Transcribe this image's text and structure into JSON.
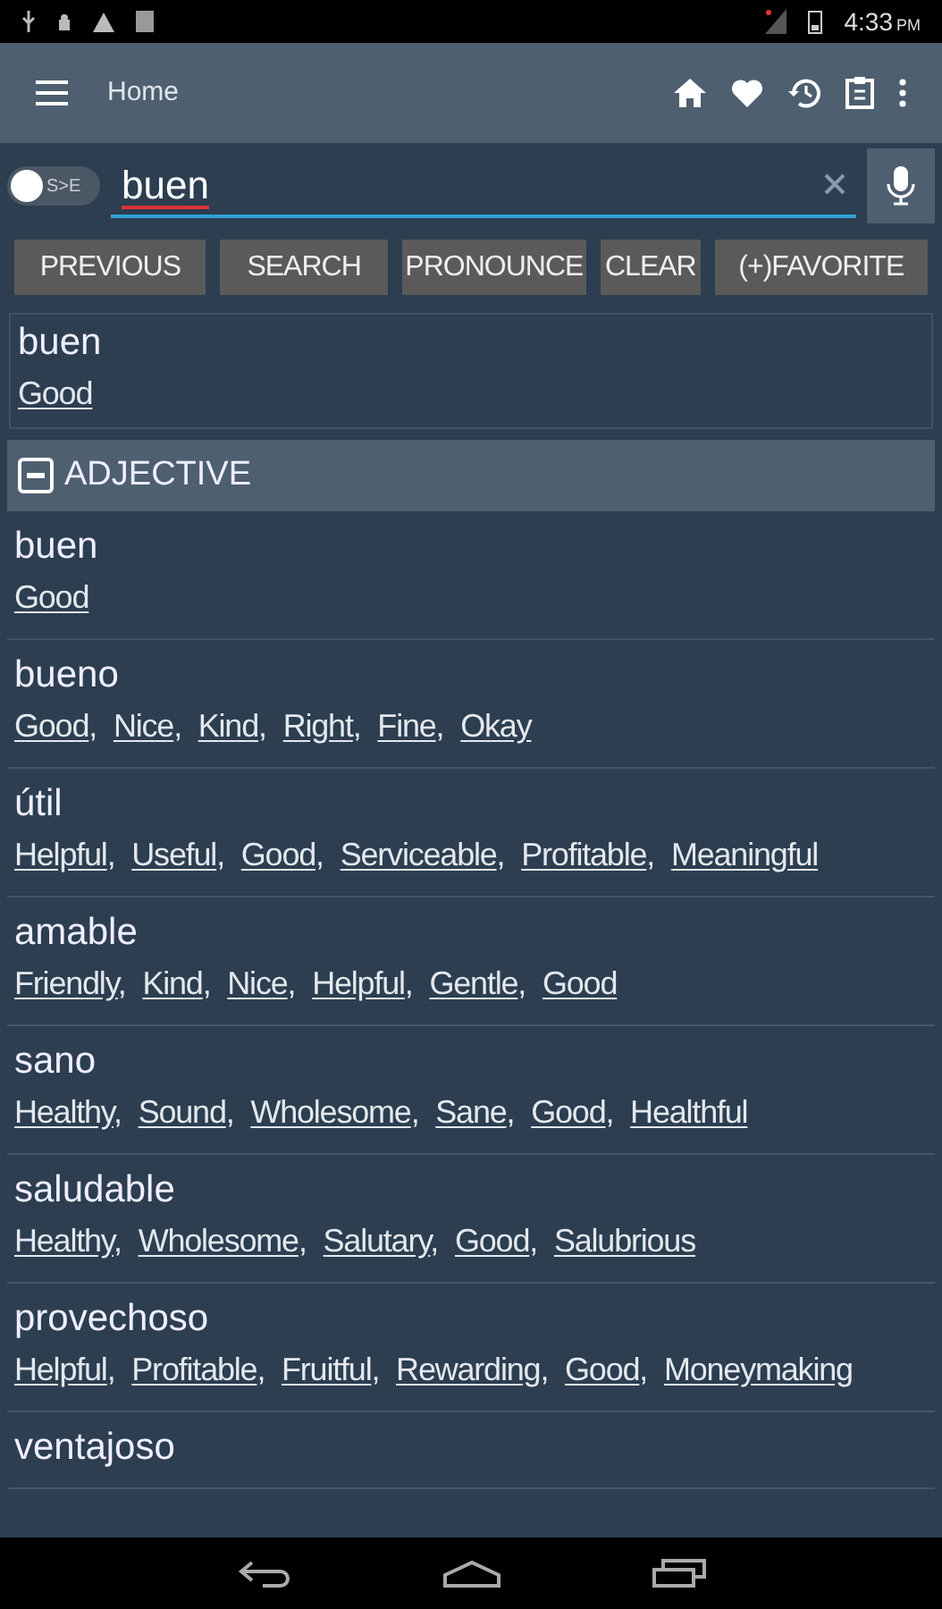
{
  "status_bar": {
    "time": "4:33",
    "meridiem": "PM"
  },
  "app_bar": {
    "title": "Home"
  },
  "search": {
    "toggle_label": "S>E",
    "toggle_on": false,
    "value": "buen"
  },
  "buttons": [
    "PREVIOUS",
    "SEARCH",
    "PRONOUNCE",
    "CLEAR",
    "(+)FAVORITE"
  ],
  "top_entry": {
    "word": "buen",
    "translations": [
      "Good"
    ]
  },
  "sections": [
    {
      "label": "ADJECTIVE",
      "expanded": true,
      "entries": [
        {
          "word": "buen",
          "translations": [
            "Good"
          ]
        },
        {
          "word": "bueno",
          "translations": [
            "Good",
            "Nice",
            "Kind",
            "Right",
            "Fine",
            "Okay"
          ]
        },
        {
          "word": "útil",
          "translations": [
            "Helpful",
            "Useful",
            "Good",
            "Serviceable",
            "Profitable",
            "Meaningful"
          ]
        },
        {
          "word": "amable",
          "translations": [
            "Friendly",
            "Kind",
            "Nice",
            "Helpful",
            "Gentle",
            "Good"
          ]
        },
        {
          "word": "sano",
          "translations": [
            "Healthy",
            "Sound",
            "Wholesome",
            "Sane",
            "Good",
            "Healthful"
          ]
        },
        {
          "word": "saludable",
          "translations": [
            "Healthy",
            "Wholesome",
            "Salutary",
            "Good",
            "Salubrious"
          ]
        },
        {
          "word": "provechoso",
          "translations": [
            "Helpful",
            "Profitable",
            "Fruitful",
            "Rewarding",
            "Good",
            "Moneymaking"
          ]
        },
        {
          "word": "ventajoso"
        }
      ]
    }
  ],
  "translation_separator": ","
}
